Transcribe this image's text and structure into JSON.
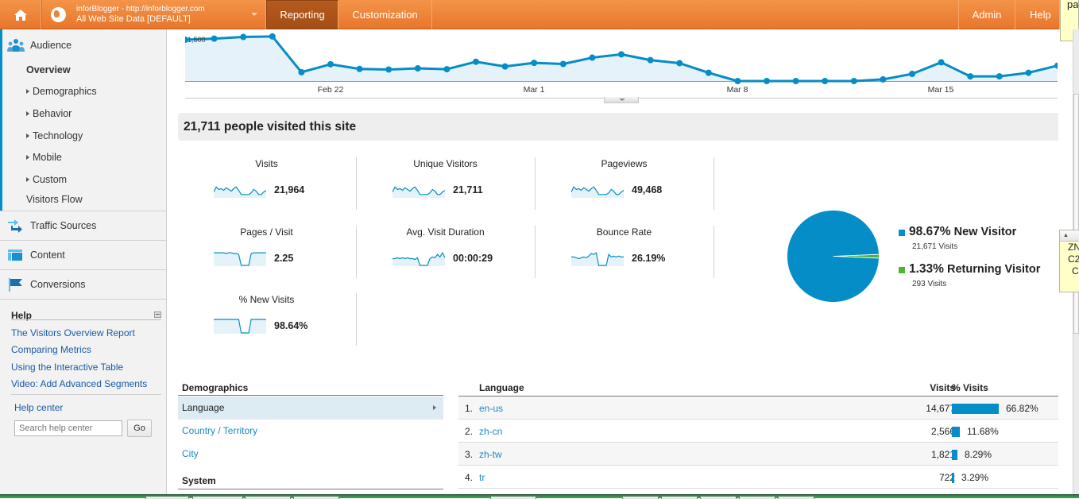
{
  "topbar": {
    "home_icon": "home-icon",
    "account_line1": "inforBlogger - http://inforblogger.com",
    "account_line2": "All Web Site Data [DEFAULT]",
    "tabs": [
      {
        "label": "Reporting",
        "active": true
      },
      {
        "label": "Customization",
        "active": false
      }
    ],
    "admin_label": "Admin",
    "help_label": "Help",
    "accent_color": "#e8762c"
  },
  "tooltip_top": {
    "text": "pa"
  },
  "sidebar": {
    "audience": {
      "label": "Audience",
      "items": [
        {
          "label": "Overview",
          "selected": true,
          "expandable": false
        },
        {
          "label": "Demographics",
          "selected": false,
          "expandable": true
        },
        {
          "label": "Behavior",
          "selected": false,
          "expandable": true
        },
        {
          "label": "Technology",
          "selected": false,
          "expandable": true
        },
        {
          "label": "Mobile",
          "selected": false,
          "expandable": true
        },
        {
          "label": "Custom",
          "selected": false,
          "expandable": true
        },
        {
          "label": "Visitors Flow",
          "selected": false,
          "expandable": false
        }
      ]
    },
    "sections": [
      {
        "label": "Traffic Sources",
        "icon": "traffic-sources-icon"
      },
      {
        "label": "Content",
        "icon": "content-icon"
      },
      {
        "label": "Conversions",
        "icon": "flag-icon"
      }
    ],
    "help": {
      "title": "Help",
      "links": [
        "The Visitors Overview Report",
        "Comparing Metrics",
        "Using the Interactive Table",
        "Video: Add Advanced Segments"
      ],
      "help_center": "Help center",
      "search_placeholder": "Search help center",
      "go_label": "Go"
    }
  },
  "visits_chart": {
    "y_label": "1,500",
    "x_ticks": [
      "Feb 22",
      "Mar 1",
      "Mar 8",
      "Mar 15"
    ],
    "series_color": "#058dc7",
    "values": [
      1500,
      1540,
      1600,
      1620,
      320,
      610,
      440,
      420,
      460,
      430,
      700,
      530,
      660,
      620,
      850,
      970,
      760,
      650,
      300,
      0,
      0,
      0,
      0,
      0,
      60,
      260,
      680,
      170,
      170,
      300,
      560
    ]
  },
  "summary": {
    "headline": "21,711 people visited this site"
  },
  "metrics": [
    {
      "label": "Visits",
      "value": "21,964",
      "spark": [
        6,
        12,
        9,
        10,
        8,
        11,
        9,
        7,
        10,
        12,
        8,
        3,
        3,
        3,
        3,
        5,
        9,
        7,
        3,
        3,
        6,
        8
      ]
    },
    {
      "label": "Unique Visitors",
      "value": "21,711",
      "spark": [
        6,
        12,
        9,
        10,
        8,
        11,
        9,
        7,
        10,
        12,
        8,
        3,
        3,
        3,
        3,
        5,
        9,
        7,
        3,
        3,
        6,
        8
      ]
    },
    {
      "label": "Pageviews",
      "value": "49,468",
      "spark": [
        6,
        12,
        9,
        10,
        8,
        11,
        9,
        7,
        10,
        12,
        8,
        3,
        3,
        3,
        3,
        5,
        9,
        7,
        3,
        3,
        6,
        8
      ]
    },
    {
      "label": "Pages / Visit",
      "value": "2.25",
      "spark": [
        15,
        15,
        15,
        15,
        15,
        14,
        15,
        15,
        14,
        14,
        13,
        0,
        0,
        0,
        0,
        14,
        15,
        15,
        15,
        15,
        15,
        15
      ]
    },
    {
      "label": "Avg. Visit Duration",
      "value": "00:00:29",
      "spark": [
        8,
        8,
        9,
        8,
        9,
        8,
        9,
        8,
        8,
        7,
        9,
        0,
        0,
        0,
        0,
        8,
        10,
        9,
        13,
        10,
        15,
        9
      ]
    },
    {
      "label": "Bounce Rate",
      "value": "26.19%",
      "spark": [
        10,
        10,
        9,
        8,
        9,
        10,
        9,
        11,
        14,
        13,
        15,
        0,
        0,
        0,
        0,
        13,
        10,
        11,
        10,
        11,
        10,
        10
      ]
    },
    {
      "label": "% New Visits",
      "value": "98.64%",
      "spark": [
        16,
        16,
        16,
        16,
        16,
        16,
        16,
        16,
        16,
        16,
        16,
        0,
        0,
        0,
        0,
        16,
        16,
        16,
        16,
        16,
        16,
        16
      ]
    }
  ],
  "visitor_pie": {
    "slices": [
      {
        "label": "New Visitor",
        "percent": 98.67,
        "pct_text": "98.67%",
        "visits_text": "21,671 Visits",
        "color": "#058dc7"
      },
      {
        "label": "Returning Visitor",
        "percent": 1.33,
        "pct_text": "1.33%",
        "visits_text": "293 Visits",
        "color": "#50b432"
      }
    ]
  },
  "demographics": {
    "heading": "Demographics",
    "items": [
      {
        "label": "Language",
        "active": true
      },
      {
        "label": "Country / Territory",
        "active": false
      },
      {
        "label": "City",
        "active": false
      }
    ],
    "system_heading": "System"
  },
  "language_table": {
    "columns": {
      "name": "Language",
      "visits": "Visits",
      "pct": "% Visits"
    },
    "rows": [
      {
        "rank": "1.",
        "name": "en-us",
        "visits": "14,677",
        "pct_text": "66.82%",
        "pct": 66.82
      },
      {
        "rank": "2.",
        "name": "zh-cn",
        "visits": "2,566",
        "pct_text": "11.68%",
        "pct": 11.68
      },
      {
        "rank": "3.",
        "name": "zh-tw",
        "visits": "1,821",
        "pct_text": "8.29%",
        "pct": 8.29
      },
      {
        "rank": "4.",
        "name": "tr",
        "visits": "722",
        "pct_text": "3.29%",
        "pct": 3.29
      }
    ]
  },
  "tooltip_side": {
    "lines": [
      "ZN",
      "C2",
      "C"
    ]
  }
}
